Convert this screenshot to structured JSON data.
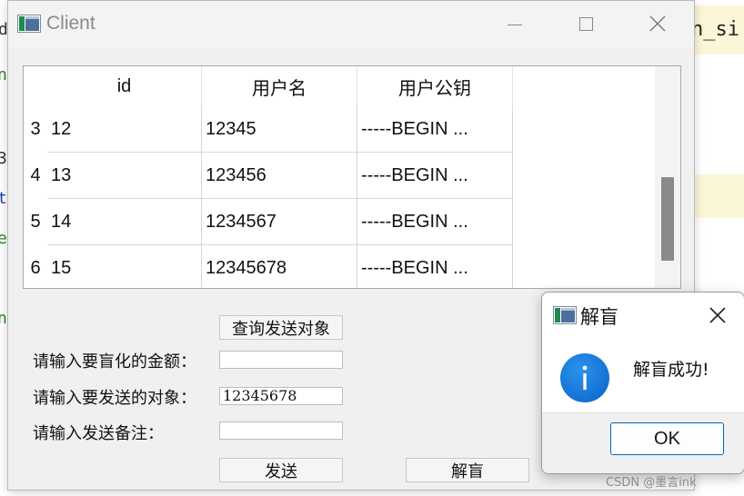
{
  "background": {
    "code_right": "n_si",
    "gutter_chars": [
      "d",
      "n",
      "3",
      "t",
      "e",
      "n"
    ]
  },
  "window": {
    "title": "Client",
    "icon": "app-window-icon",
    "controls": [
      "minimize-icon",
      "maximize-icon",
      "close-icon"
    ]
  },
  "table": {
    "columns": [
      "id",
      "用户名",
      "用户公钥"
    ],
    "rows": [
      {
        "row": "3",
        "id": "12",
        "username": "12345",
        "pubkey": "-----BEGIN ..."
      },
      {
        "row": "4",
        "id": "13",
        "username": "123456",
        "pubkey": "-----BEGIN ..."
      },
      {
        "row": "5",
        "id": "14",
        "username": "1234567",
        "pubkey": "-----BEGIN ..."
      },
      {
        "row": "6",
        "id": "15",
        "username": "12345678",
        "pubkey": "-----BEGIN ..."
      }
    ]
  },
  "form": {
    "query_button": "查询发送对象",
    "amount_label": "请输入要盲化的金额：",
    "amount_value": "",
    "target_label": "请输入要发送的对象：",
    "target_value": "12345678",
    "note_label": "请输入发送备注：",
    "note_value": "",
    "send_button": "发送",
    "unblind_button": "解盲"
  },
  "dialog": {
    "title": "解盲",
    "message": "解盲成功!",
    "ok_button": "OK",
    "icon": "info-icon"
  },
  "watermark": "CSDN @墨言ink"
}
